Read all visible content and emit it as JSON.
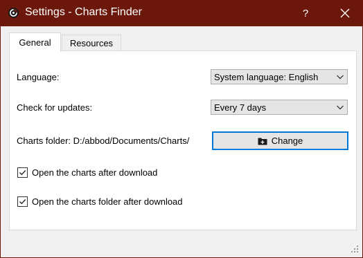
{
  "window": {
    "title": "Settings - Charts Finder",
    "help_glyph": "?"
  },
  "tabs": [
    {
      "label": "General",
      "active": true
    },
    {
      "label": "Resources",
      "active": false
    }
  ],
  "general": {
    "language_label": "Language:",
    "language_value": "System language: English",
    "updates_label": "Check for updates:",
    "updates_value": "Every 7 days",
    "folder_label": "Charts folder:",
    "folder_path": "D:/abbod/Documents/Charts/",
    "change_label": "Change",
    "checkbox_open_charts": {
      "label": "Open the charts after download",
      "checked": true
    },
    "checkbox_open_folder": {
      "label": "Open the charts folder after download",
      "checked": true
    }
  },
  "colors": {
    "titlebar": "#6b170b",
    "focus_accent": "#0078d7"
  },
  "icons": [
    "app-logo-icon",
    "help-icon",
    "close-icon",
    "chevron-down-icon",
    "folder-add-icon",
    "checkmark-icon",
    "resize-grip-icon"
  ]
}
